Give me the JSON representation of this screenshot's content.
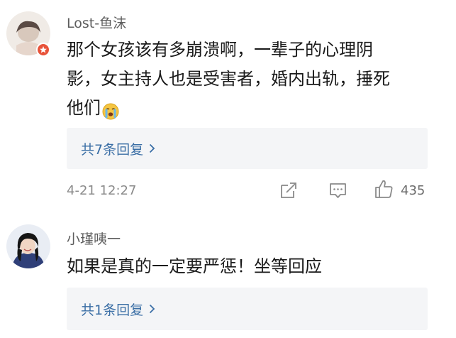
{
  "comments": [
    {
      "username": "Lost-鱼沫",
      "avatar_icon": "girl-portrait-avatar",
      "badge_color": "#e8533a",
      "lines": [
        "那个女孩该有多崩溃啊，一辈子的心理阴",
        "影，女主持人也是受害者，婚内出轨，捶死",
        "他们"
      ],
      "emoji": "crying-face-emoji",
      "reply_link": "共7条回复",
      "time": "4-21 12:27",
      "actions": {
        "share_icon": "share-icon",
        "comment_icon": "comment-icon",
        "like_icon": "thumbs-up-icon",
        "like_count": "435"
      }
    },
    {
      "username": "小瑾咦一",
      "avatar_icon": "user-photo-avatar",
      "lines": [
        "如果是真的一定要严惩！坐等回应"
      ],
      "reply_link": "共1条回复"
    }
  ],
  "colors": {
    "link": "#3a6ea5",
    "reply_bg": "#f4f5f7",
    "text": "#1a1a1a",
    "meta": "#8a8a8a"
  }
}
